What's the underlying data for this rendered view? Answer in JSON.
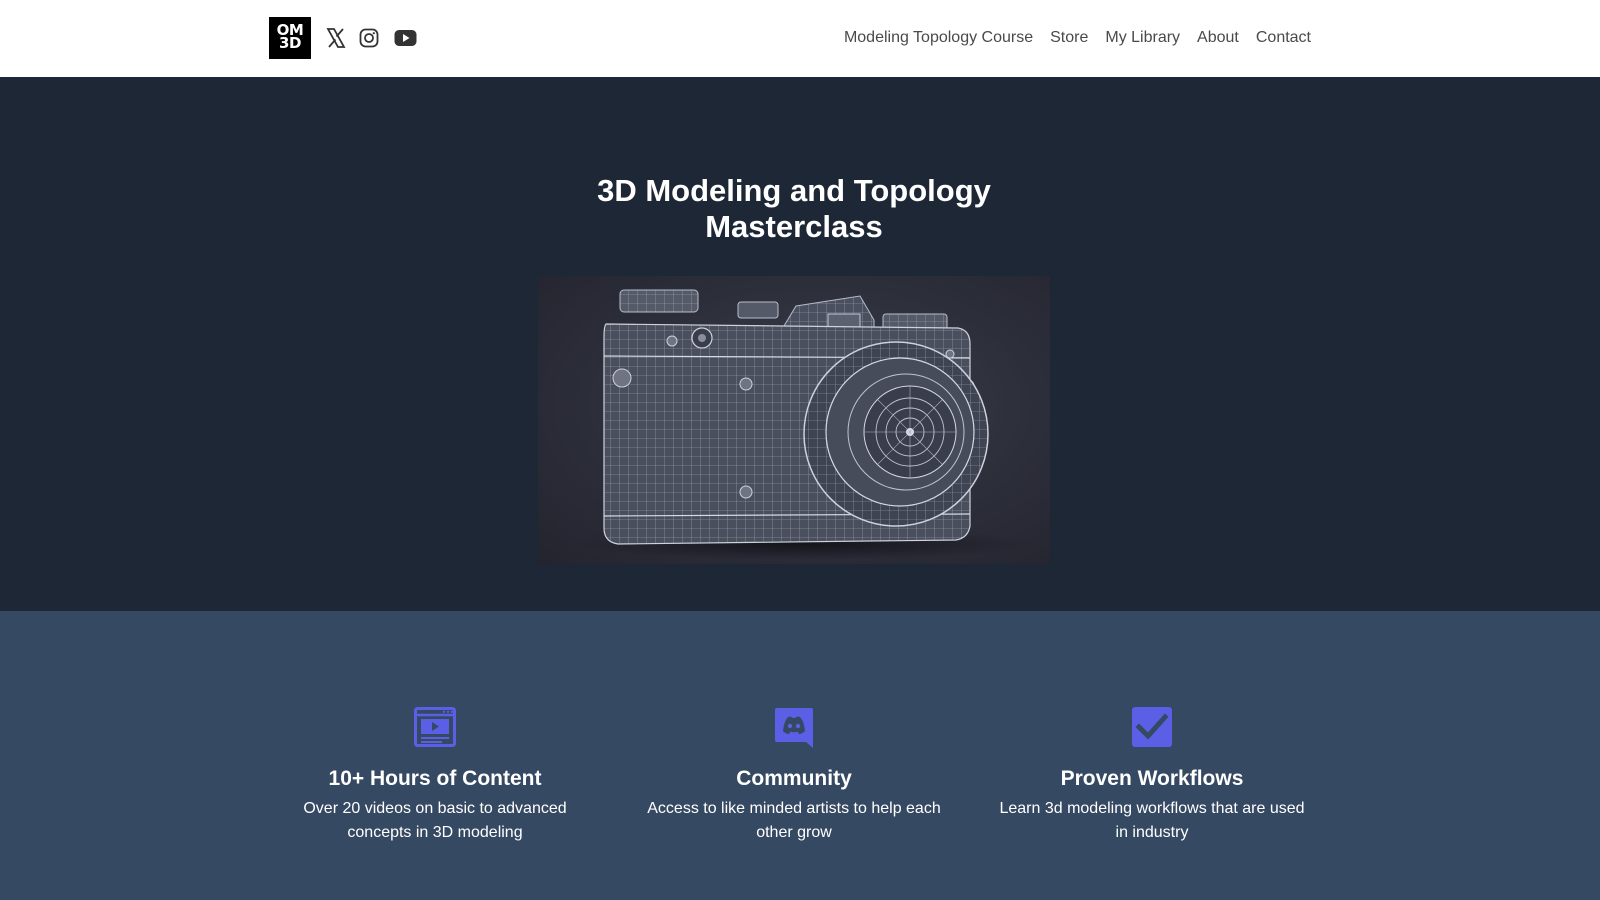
{
  "header": {
    "logo_line1": "OM",
    "logo_line2": "3D",
    "social_icons": [
      "x-icon",
      "instagram-icon",
      "youtube-icon"
    ],
    "nav": [
      {
        "label": "Modeling Topology Course"
      },
      {
        "label": "Store"
      },
      {
        "label": "My Library"
      },
      {
        "label": "About"
      },
      {
        "label": "Contact"
      }
    ]
  },
  "hero": {
    "title_line1": "3D Modeling and Topology",
    "title_line2": "Masterclass",
    "image_subject": "wireframe-camera-render"
  },
  "features": [
    {
      "icon": "video-player-icon",
      "title": "10+ Hours of Content",
      "desc_line1": "Over 20 videos on basic to advanced",
      "desc_line2": "concepts in 3D modeling"
    },
    {
      "icon": "discord-icon",
      "title": "Community",
      "desc_line1": "Access to like minded artists to help each",
      "desc_line2": "other grow"
    },
    {
      "icon": "checkbox-check-icon",
      "title": "Proven Workflows",
      "desc_line1": "Learn 3d modeling workflows that are used",
      "desc_line2": "in industry"
    }
  ],
  "colors": {
    "header_bg": "#ffffff",
    "hero_bg": "#1d2736",
    "features_bg": "#364962",
    "accent": "#5b5fe6",
    "nav_text": "#4a4a4a"
  }
}
